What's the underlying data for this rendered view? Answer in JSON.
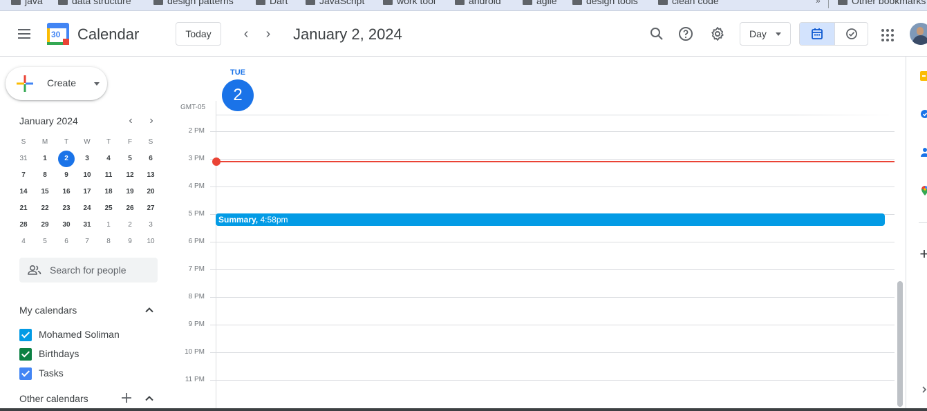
{
  "bookmarks": {
    "items": [
      "java",
      "data structure",
      "design patterns",
      "Dart",
      "JavaScript",
      "work tool",
      "android",
      "agile",
      "design tools",
      "clean code"
    ],
    "overflow": "»",
    "other": "Other bookmarks"
  },
  "header": {
    "menu_icon": "hamburger-menu-icon",
    "logo_number": "30",
    "app_title": "Calendar",
    "today_label": "Today",
    "prev_icon": "‹",
    "next_icon": "›",
    "date_title": "January 2, 2024",
    "view_label": "Day"
  },
  "sidebar": {
    "create_label": "Create",
    "mini_calendar": {
      "title": "January 2024",
      "prev": "‹",
      "next": "›",
      "weekdays": [
        "S",
        "M",
        "T",
        "W",
        "T",
        "F",
        "S"
      ],
      "weeks": [
        [
          "31",
          "1",
          "2",
          "3",
          "4",
          "5",
          "6"
        ],
        [
          "7",
          "8",
          "9",
          "10",
          "11",
          "12",
          "13"
        ],
        [
          "14",
          "15",
          "16",
          "17",
          "18",
          "19",
          "20"
        ],
        [
          "21",
          "22",
          "23",
          "24",
          "25",
          "26",
          "27"
        ],
        [
          "28",
          "29",
          "30",
          "31",
          "1",
          "2",
          "3"
        ],
        [
          "4",
          "5",
          "6",
          "7",
          "8",
          "9",
          "10"
        ]
      ],
      "selected_day": "2"
    },
    "search_people_placeholder": "Search for people",
    "my_calendars_title": "My calendars",
    "my_calendars": [
      {
        "label": "Mohamed Soliman",
        "color": "#039be5",
        "checked": true
      },
      {
        "label": "Birthdays",
        "color": "#0b8043",
        "checked": true
      },
      {
        "label": "Tasks",
        "color": "#4285f4",
        "checked": true
      }
    ],
    "other_calendars_title": "Other calendars"
  },
  "day_view": {
    "day_of_week": "TUE",
    "day_number": "2",
    "timezone": "GMT-05",
    "hours": [
      "2 PM",
      "3 PM",
      "4 PM",
      "5 PM",
      "6 PM",
      "7 PM",
      "8 PM",
      "9 PM",
      "10 PM",
      "11 PM"
    ],
    "current_time_hour": "3 PM",
    "event": {
      "title": "Summary,",
      "time": "4:58pm",
      "color": "#039be5"
    }
  },
  "colors": {
    "accent": "#1a73e8",
    "now_line": "#ea4335",
    "event": "#039be5"
  }
}
